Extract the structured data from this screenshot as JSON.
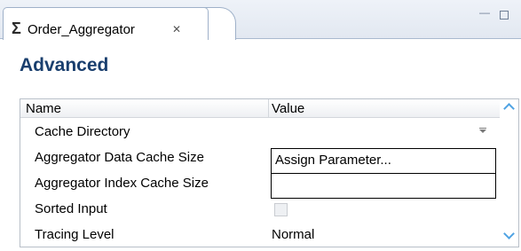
{
  "tab": {
    "icon": "sigma-icon",
    "icon_glyph": "Σ",
    "title": "Order_Aggregator",
    "close_glyph": "✕"
  },
  "window_controls": {
    "minimize_glyph": "▭",
    "maximize_glyph": ""
  },
  "section": {
    "title": "Advanced"
  },
  "table": {
    "columns": [
      "Name",
      "Value"
    ],
    "rows": [
      {
        "name": "Cache Directory",
        "value": "",
        "control": "dropdown"
      },
      {
        "name": "Aggregator Data Cache Size",
        "value": "Assign Parameter...",
        "control": "param-menu"
      },
      {
        "name": "Aggregator Index Cache Size",
        "value": "",
        "control": "param-menu"
      },
      {
        "name": "Sorted Input",
        "value": "",
        "control": "checkbox",
        "checked": false
      },
      {
        "name": "Tracing Level",
        "value": "Normal",
        "control": "text"
      }
    ]
  },
  "colors": {
    "section_title": "#1a3f6e",
    "scroll_arrow": "#4fa3e3",
    "tab_border": "#9fb1c9"
  }
}
